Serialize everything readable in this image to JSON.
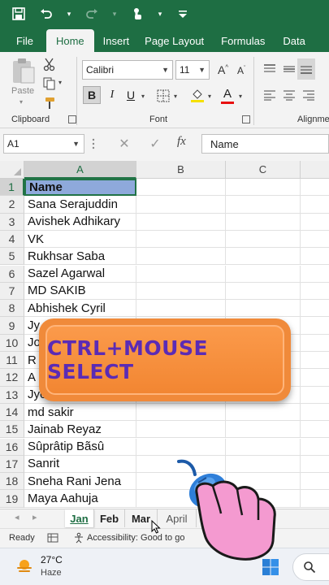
{
  "qat": {
    "icons": [
      "save-icon",
      "undo-icon",
      "redo-icon",
      "touch-mode-icon",
      "customize-icon"
    ]
  },
  "ribbon_tabs": [
    "File",
    "Home",
    "Insert",
    "Page Layout",
    "Formulas",
    "Data"
  ],
  "active_tab": "Home",
  "clipboard": {
    "paste_label": "Paste",
    "group_label": "Clipboard"
  },
  "font": {
    "name": "Calibri",
    "size": "11",
    "bold": "B",
    "italic": "I",
    "underline": "U",
    "group_label": "Font"
  },
  "alignment": {
    "group_label": "Alignme"
  },
  "formula_bar": {
    "name_box": "A1",
    "fx": "fx",
    "content": "Name"
  },
  "columns": [
    "A",
    "B",
    "C"
  ],
  "rows": [
    {
      "num": "1",
      "a": "Name"
    },
    {
      "num": "2",
      "a": "Sana Serajuddin"
    },
    {
      "num": "3",
      "a": "Avishek Adhikary"
    },
    {
      "num": "4",
      "a": "VK"
    },
    {
      "num": "5",
      "a": "Rukhsar Saba"
    },
    {
      "num": "6",
      "a": "Sazel Agarwal"
    },
    {
      "num": "7",
      "a": "MD SAKIB"
    },
    {
      "num": "8",
      "a": "Abhishek Cyril"
    },
    {
      "num": "9",
      "a": "Jy"
    },
    {
      "num": "10",
      "a": "Jo"
    },
    {
      "num": "11",
      "a": "R"
    },
    {
      "num": "12",
      "a": "A"
    },
    {
      "num": "13",
      "a": "Jyo"
    },
    {
      "num": "14",
      "a": "md sakir"
    },
    {
      "num": "15",
      "a": "Jainab Reyaz"
    },
    {
      "num": "16",
      "a": "Sûprâtip Bãsû"
    },
    {
      "num": "17",
      "a": "Sanrit"
    },
    {
      "num": "18",
      "a": "Sneha Rani Jena"
    },
    {
      "num": "19",
      "a": "Maya Aahuja"
    }
  ],
  "sheets": [
    "Jan",
    "Feb",
    "Mar",
    "April"
  ],
  "active_sheet": "Jan",
  "status": {
    "ready": "Ready",
    "accessibility": "Accessibility: Good to go"
  },
  "taskbar": {
    "temperature": "27°C",
    "condition": "Haze"
  },
  "overlay": {
    "banner_text": "CTRL+MOUSE SELECT"
  },
  "colors": {
    "excel_green": "#1e6e43",
    "header_fill": "#8ea9db",
    "banner_orange": "#f28632",
    "banner_text": "#5b2bb5"
  }
}
